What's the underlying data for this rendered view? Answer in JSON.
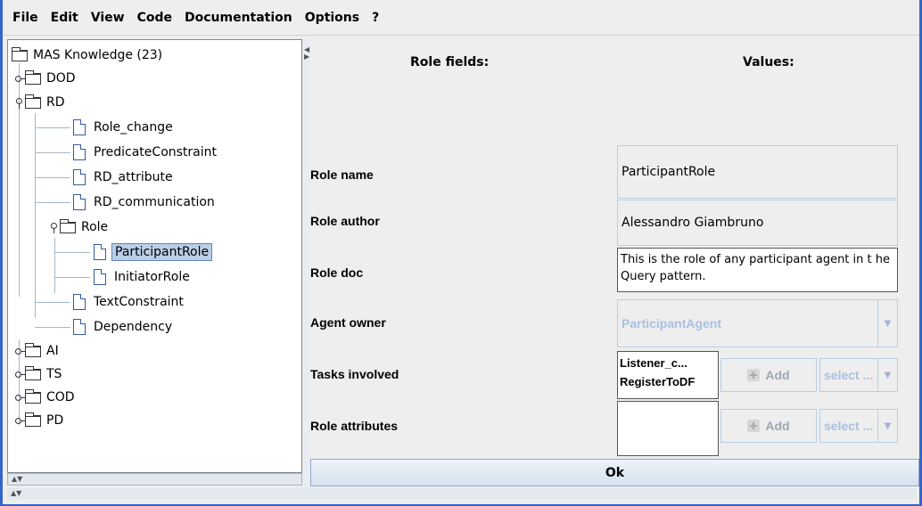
{
  "menu": [
    "File",
    "Edit",
    "View",
    "Code",
    "Documentation",
    "Options",
    "?"
  ],
  "tree": {
    "root": "MAS Knowledge (23)",
    "nodes": [
      {
        "label": "DOD",
        "type": "folder",
        "state": "collapsed"
      },
      {
        "label": "RD",
        "type": "folder",
        "state": "expanded"
      },
      {
        "label": "Role_change",
        "type": "leaf"
      },
      {
        "label": "PredicateConstraint",
        "type": "leaf"
      },
      {
        "label": "RD_attribute",
        "type": "leaf"
      },
      {
        "label": "RD_communication",
        "type": "leaf"
      },
      {
        "label": "Role",
        "type": "folder",
        "state": "expanded"
      },
      {
        "label": "ParticipantRole",
        "type": "leaf",
        "selected": true
      },
      {
        "label": "InitiatorRole",
        "type": "leaf"
      },
      {
        "label": "TextConstraint",
        "type": "leaf"
      },
      {
        "label": "Dependency",
        "type": "leaf"
      },
      {
        "label": "AI",
        "type": "folder",
        "state": "collapsed"
      },
      {
        "label": "TS",
        "type": "folder",
        "state": "collapsed"
      },
      {
        "label": "COD",
        "type": "folder",
        "state": "collapsed"
      },
      {
        "label": "PD",
        "type": "folder",
        "state": "collapsed"
      }
    ]
  },
  "form": {
    "header_fields": "Role fields:",
    "header_values": "Values:",
    "role_name_label": "Role name",
    "role_name_value": "ParticipantRole",
    "role_author_label": "Role author",
    "role_author_value": "Alessandro Giambruno",
    "role_doc_label": "Role doc",
    "role_doc_value": "This is the role of any participant agent in t he Query pattern.",
    "agent_owner_label": "Agent owner",
    "agent_owner_value": "ParticipantAgent",
    "tasks_label": "Tasks involved",
    "tasks_items": [
      "Listener_c...",
      "RegisterToDF"
    ],
    "add_label": "Add",
    "select_placeholder": "select ...",
    "attributes_label": "Role attributes"
  },
  "ok_label": "Ok"
}
